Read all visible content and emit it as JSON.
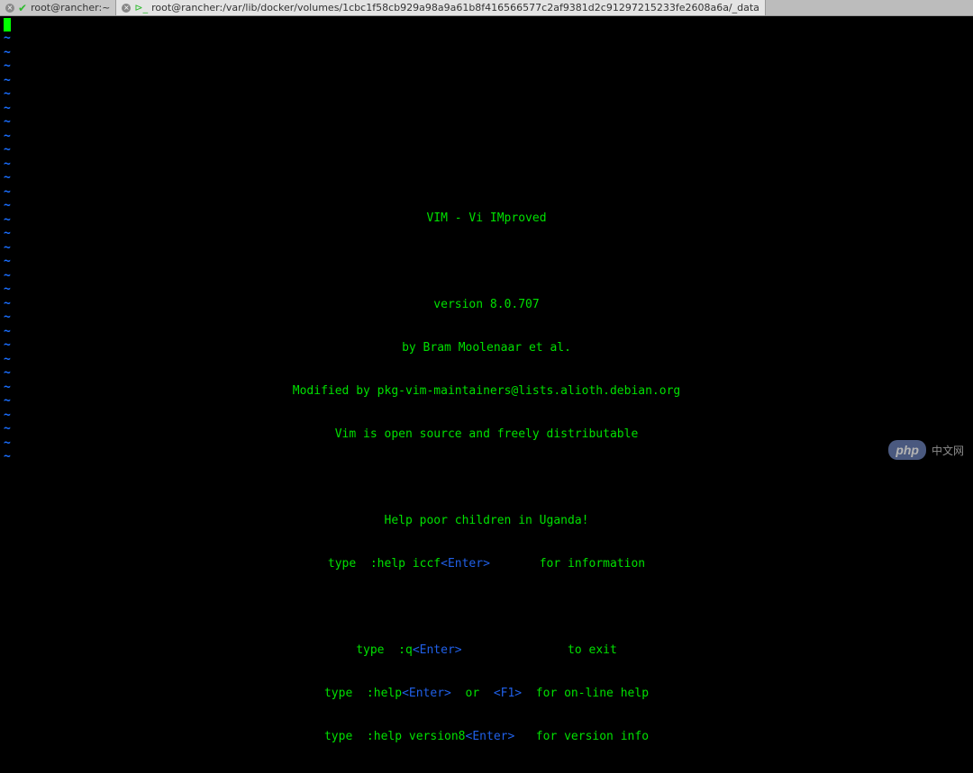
{
  "tabs": {
    "tab1_label": "root@rancher:~",
    "tab2_label": "root@rancher:/var/lib/docker/volumes/1cbc1f58cb929a98a9a61b8f416566577c2af9381d2c91297215233fe2608a6a/_data"
  },
  "tilde": "~",
  "vim": {
    "title": "VIM - Vi IMproved",
    "version": "version 8.0.707",
    "author": "by Bram Moolenaar et al.",
    "modified": "Modified by pkg-vim-maintainers@lists.alioth.debian.org",
    "opensource": "Vim is open source and freely distributable",
    "charity": "Help poor children in Uganda!",
    "help_iccf_pre": "type  :help iccf",
    "enter": "<Enter>",
    "help_iccf_post": "       for information",
    "quit_pre": "type  :q",
    "quit_post": "               to exit",
    "help_pre": "type  :help",
    "help_mid": "  or  ",
    "f1": "<F1>",
    "help_post": "  for on-line help",
    "ver_pre": "type  :help version8",
    "ver_post": "   for version info"
  },
  "watermark": {
    "logo": "php",
    "text": "中文网"
  }
}
